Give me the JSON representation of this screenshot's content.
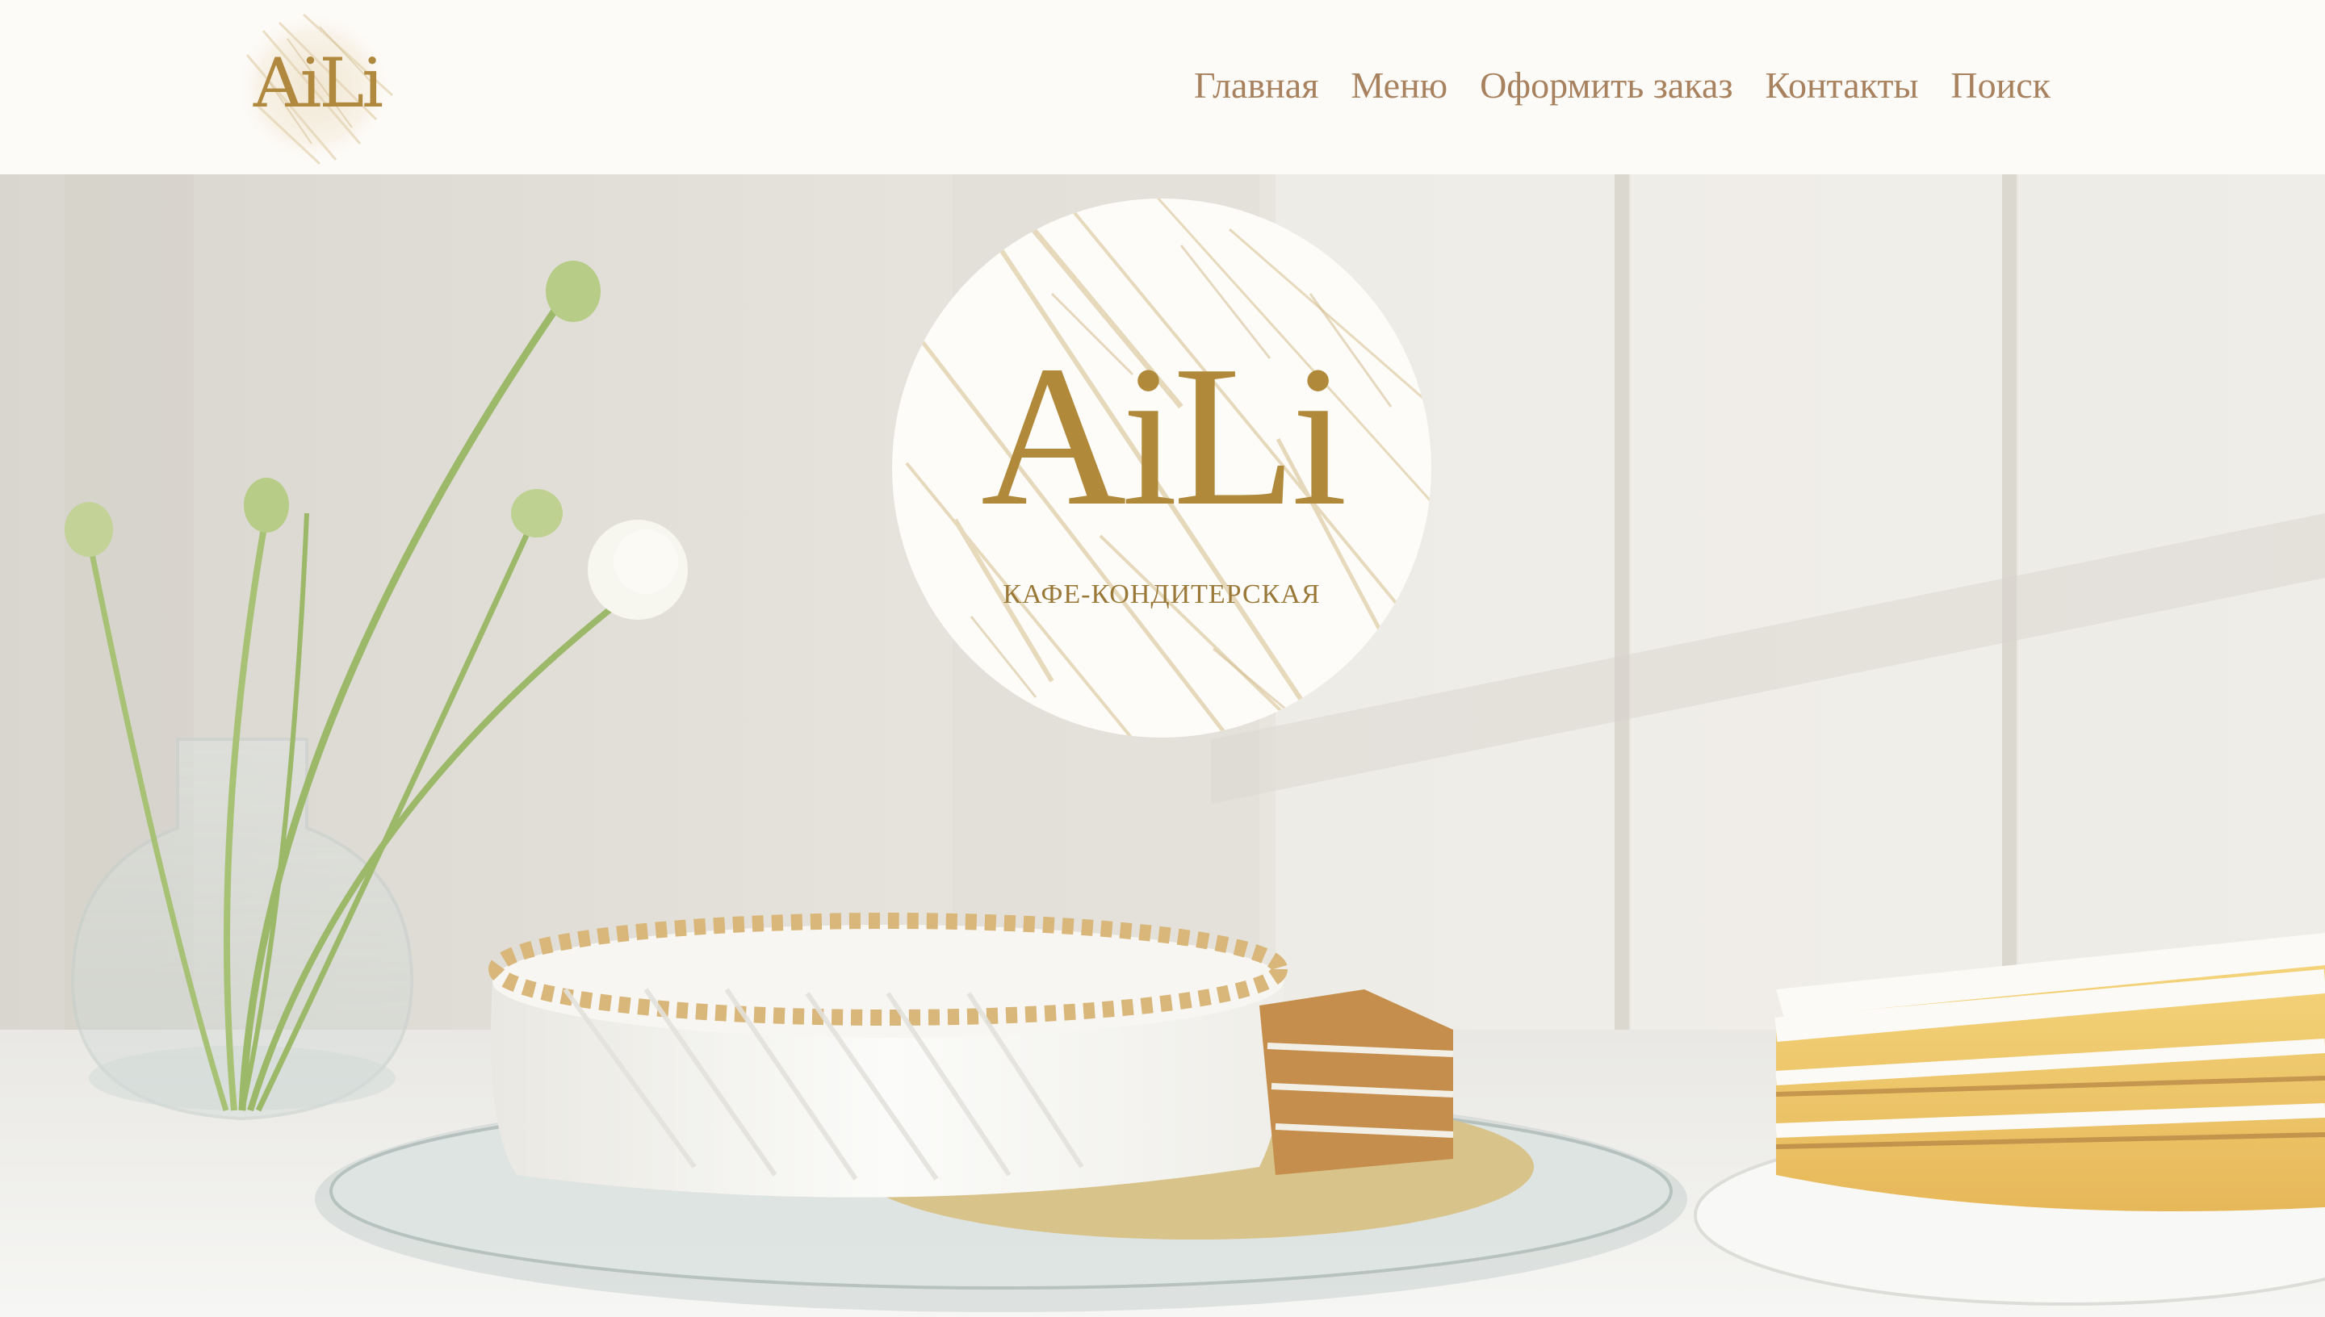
{
  "brand": {
    "logo_text": "AiLi",
    "subtitle": "КАФЕ-КОНДИТЕРСКАЯ"
  },
  "nav": {
    "items": [
      {
        "label": "Главная",
        "icon": ""
      },
      {
        "label": "Меню",
        "icon": ""
      },
      {
        "label": "Оформить заказ",
        "icon": ""
      },
      {
        "label": "Контакты",
        "icon": ""
      },
      {
        "label": "Поиск",
        "icon": ""
      }
    ]
  },
  "colors": {
    "gold": "#b08a3a",
    "nav_text": "#a8825f",
    "header_bg": "#fdfbf8"
  },
  "hero": {
    "image": "cake-on-glass-plate-with-flowers-in-vase"
  }
}
